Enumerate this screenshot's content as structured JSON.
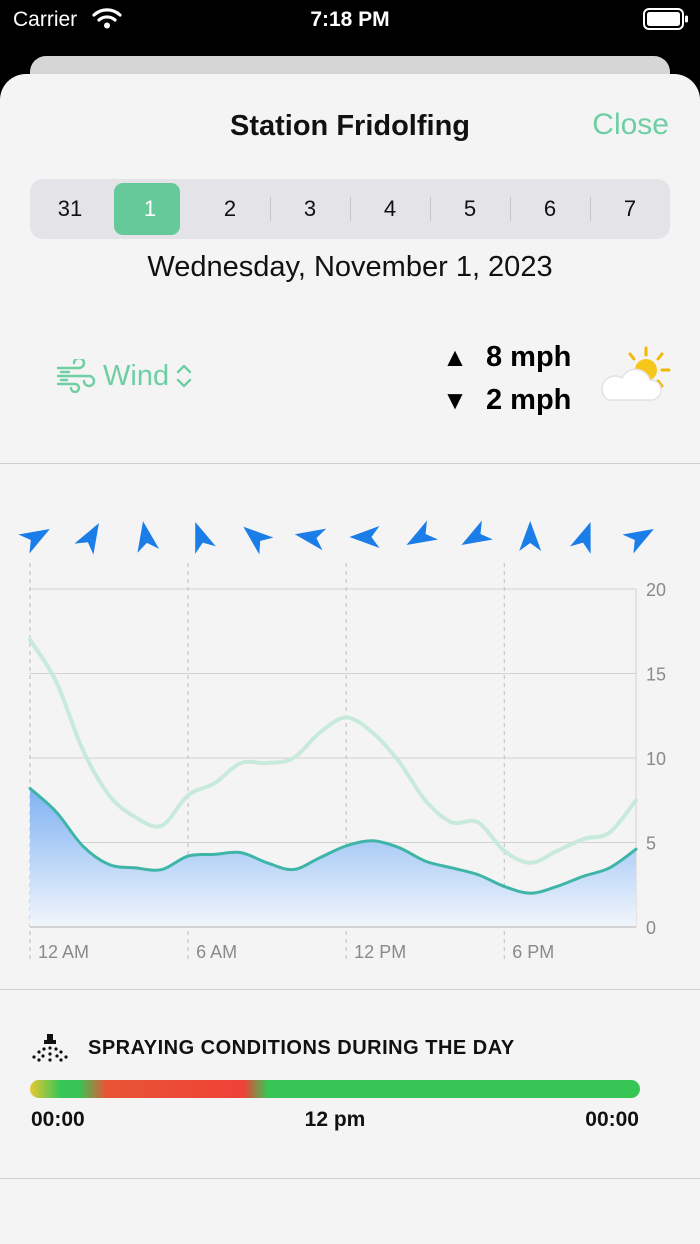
{
  "status_bar": {
    "carrier": "Carrier",
    "time": "7:18 PM"
  },
  "header": {
    "title": "Station Fridolfing",
    "close_label": "Close"
  },
  "days": [
    "31",
    "1",
    "2",
    "3",
    "4",
    "5",
    "6",
    "7"
  ],
  "selected_day_index": 1,
  "date_label": "Wednesday, November 1, 2023",
  "metric": {
    "label": "Wind",
    "icon": "wind-icon"
  },
  "speeds": {
    "max_label": "8 mph",
    "min_label": "2 mph",
    "max_icon": "triangle-up-icon",
    "min_icon": "triangle-down-icon"
  },
  "weather_icon": "partly-cloudy-icon",
  "wind_directions_deg": [
    60,
    30,
    350,
    340,
    310,
    280,
    270,
    240,
    240,
    0,
    20,
    60
  ],
  "colors": {
    "accent": "#66c999",
    "arrow": "#1a7de8",
    "gust_line": "#c8eadb",
    "speed_line": "#3fb5a8",
    "fill_top": "#7fb2f2",
    "fill_bottom": "#f2f6fc",
    "spray_good": "#37c656",
    "spray_bad": "#ef4136",
    "spray_warn": "#e8c733"
  },
  "chart_data": {
    "type": "area",
    "x_tick_labels": [
      "12 AM",
      "6 AM",
      "12 PM",
      "6 PM"
    ],
    "y_ticks": [
      0,
      5,
      10,
      15,
      20
    ],
    "ylim": [
      0,
      20
    ],
    "xlim": [
      0,
      23
    ],
    "gridlines": true,
    "series": [
      {
        "kind": "line",
        "hours": [
          0,
          1,
          2,
          3,
          4,
          5,
          6,
          7,
          8,
          9,
          10,
          11,
          12,
          13,
          14,
          15,
          16,
          17,
          18,
          19,
          20,
          21,
          22,
          23
        ],
        "values": [
          17,
          14.5,
          10.5,
          7.8,
          6.5,
          6,
          7.8,
          8.5,
          9.7,
          9.7,
          10,
          11.5,
          12.4,
          11.5,
          9.8,
          7.5,
          6.2,
          6.2,
          4.5,
          3.8,
          4.5,
          5.2,
          5.6,
          7.5
        ]
      },
      {
        "kind": "area",
        "hours": [
          0,
          1,
          2,
          3,
          4,
          5,
          6,
          7,
          8,
          9,
          10,
          11,
          12,
          13,
          14,
          15,
          16,
          17,
          18,
          19,
          20,
          21,
          22,
          23
        ],
        "values": [
          8.2,
          6.8,
          4.8,
          3.7,
          3.5,
          3.4,
          4.2,
          4.3,
          4.4,
          3.8,
          3.4,
          4.1,
          4.8,
          5.1,
          4.7,
          3.9,
          3.5,
          3.1,
          2.4,
          2,
          2.4,
          3,
          3.5,
          4.6
        ]
      }
    ]
  },
  "spraying": {
    "title": "SPRAYING CONDITIONS DURING THE DAY",
    "start_label": "00:00",
    "mid_label": "12 pm",
    "end_label": "00:00",
    "icon": "sprayer-icon"
  }
}
